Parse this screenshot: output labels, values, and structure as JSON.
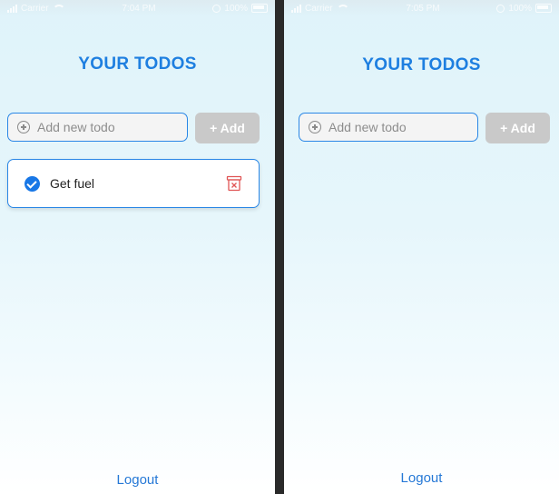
{
  "screens": [
    {
      "status_bar": {
        "carrier": "Carrier",
        "time": "7:04 PM",
        "battery": "100%"
      },
      "title": "YOUR TODOS",
      "input": {
        "placeholder": "Add new todo",
        "value": ""
      },
      "add_button": {
        "label": "+ Add"
      },
      "todos": [
        {
          "text": "Get fuel",
          "completed": true
        }
      ],
      "logout": "Logout"
    },
    {
      "status_bar": {
        "carrier": "Carrier",
        "time": "7:05 PM",
        "battery": "100%"
      },
      "title": "YOUR TODOS",
      "input": {
        "placeholder": "Add new todo",
        "value": ""
      },
      "add_button": {
        "label": "+ Add"
      },
      "todos": [],
      "logout": "Logout"
    }
  ],
  "icons": {
    "add_input": "plus-circle-icon",
    "todo_check": "check-circle-icon",
    "delete": "trash-icon"
  },
  "colors": {
    "accent": "#1e7fe0",
    "button_disabled": "#c9c9c9",
    "delete": "#e05555",
    "check": "#1877e6"
  }
}
